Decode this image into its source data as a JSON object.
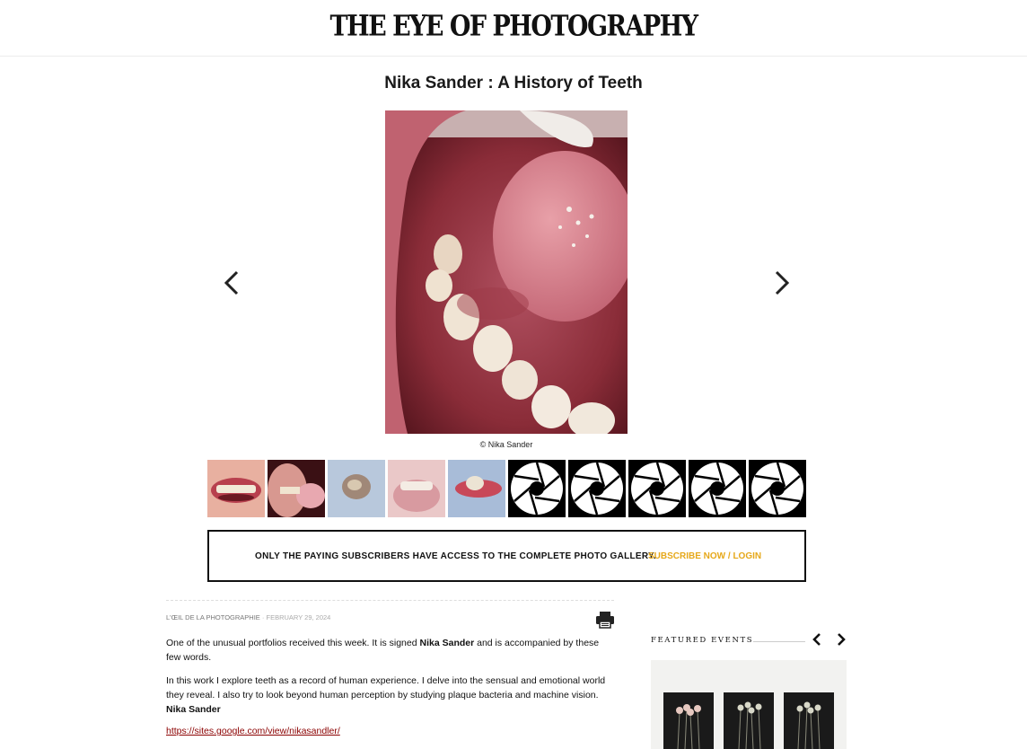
{
  "site": {
    "logo": "THE EYE OF PHOTOGRAPHY"
  },
  "article": {
    "title": "Nika Sander : A History of Teeth",
    "photo_credit": "© Nika Sander",
    "author": "L'ŒIL DE LA PHOTOGRAPHIE",
    "separator": "·",
    "date": "FEBRUARY 29, 2024",
    "p1_a": "One of the unusual portfolios received this week. It is signed ",
    "p1_name": "Nika Sander",
    "p1_b": " and is accompanied by these few words.",
    "p2": "In this work I explore teeth as a record of human experience. I delve into the sensual and emotional world they reveal. I also try to look beyond human perception by studying plaque bacteria and machine vision.",
    "p2_sig": "Nika Sander",
    "link": "https://sites.google.com/view/nikasandler/"
  },
  "gallery": {
    "thumbnails": [
      "smile",
      "open-mouth",
      "tooth-object",
      "mouth-blur",
      "tooth-on-gum",
      "locked",
      "locked",
      "locked",
      "locked",
      "locked"
    ]
  },
  "paywall": {
    "text": "ONLY THE PAYING SUBSCRIBERS HAVE ACCESS TO THE COMPLETE PHOTO GALLERY.",
    "link": "SUBSCRIBE NOW / LOGIN",
    "accent": "#e6a81a"
  },
  "sidebar": {
    "featured_label": "FEATURED EVENTS"
  },
  "icons": {
    "prev": "chevron-left-icon",
    "next": "chevron-right-icon",
    "print": "printer-icon",
    "locked": "aperture-icon"
  }
}
